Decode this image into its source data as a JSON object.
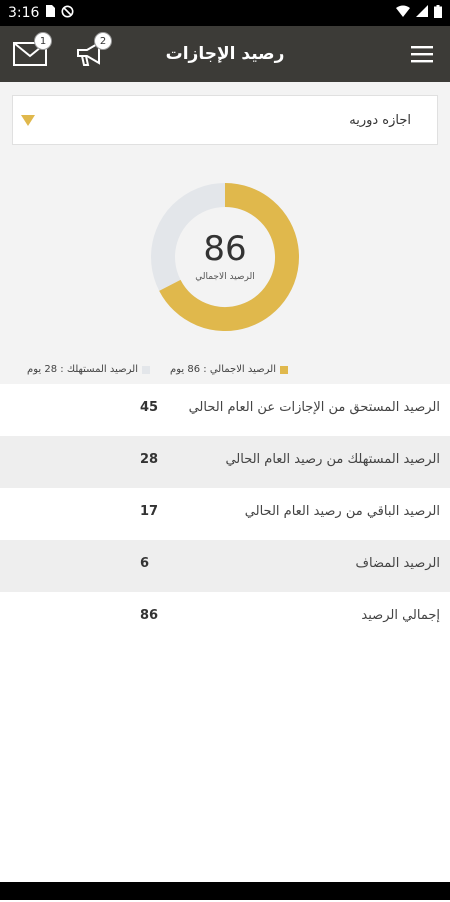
{
  "status_bar": {
    "time": "3:16"
  },
  "appbar": {
    "title": "رصيد الإجازات",
    "mail_badge": "1",
    "announcement_badge": "2"
  },
  "dropdown": {
    "selected": "اجازه دوريه"
  },
  "chart_data": {
    "type": "pie",
    "center_value": "86",
    "center_caption": "الرصيد الاجمالي",
    "slices": [
      {
        "name": "الرصيد الاجمالي",
        "value": 86,
        "color": "#e0b84c"
      },
      {
        "name": "الرصيد المستهلك",
        "value": 28,
        "color": "#e3e6ea"
      }
    ]
  },
  "legend": {
    "total": "الرصيد الاجمالي : 86 يوم",
    "consumed": "الرصيد المستهلك : 28 يوم"
  },
  "rows": [
    {
      "label": "الرصيد المستحق من الإجازات عن العام الحالي",
      "value": "45"
    },
    {
      "label": "الرصيد المستهلك من رصيد العام الحالي",
      "value": "28"
    },
    {
      "label": "الرصيد الباقي من رصيد العام الحالي",
      "value": "17"
    },
    {
      "label": "الرصيد المضاف",
      "value": "6"
    },
    {
      "label": "إجمالي الرصيد",
      "value": "86"
    }
  ],
  "colors": {
    "appbar": "#3c3b37",
    "accent": "#e0b84c",
    "track": "#e3e6ea"
  }
}
